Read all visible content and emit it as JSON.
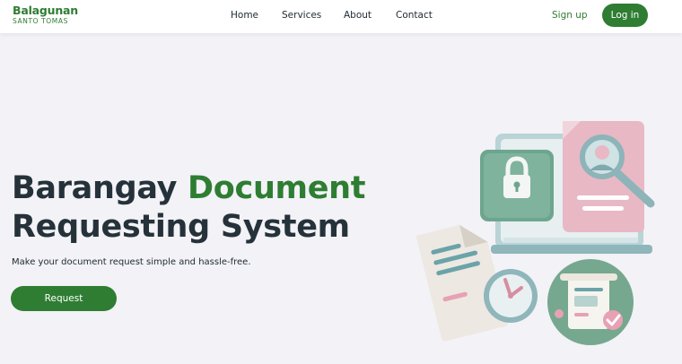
{
  "brand": {
    "name": "Balagunan",
    "subtitle": "SANTO TOMAS"
  },
  "nav": {
    "home": "Home",
    "services": "Services",
    "about": "About",
    "contact": "Contact",
    "signup": "Sign up",
    "login": "Log in"
  },
  "hero": {
    "title_part1": "Barangay ",
    "title_accent": "Document",
    "title_part2": "Requesting  System",
    "subtitle": "Make your document request simple and hassle-free.",
    "cta": "Request"
  },
  "colors": {
    "accent": "#2e7d32",
    "background": "#f2f2f7",
    "text": "#26323a"
  },
  "illustration": {
    "icons": [
      "lock-icon",
      "profile-document-icon",
      "magnifier-icon",
      "document-icon",
      "clock-icon",
      "certificate-icon",
      "checkmark-icon"
    ]
  }
}
